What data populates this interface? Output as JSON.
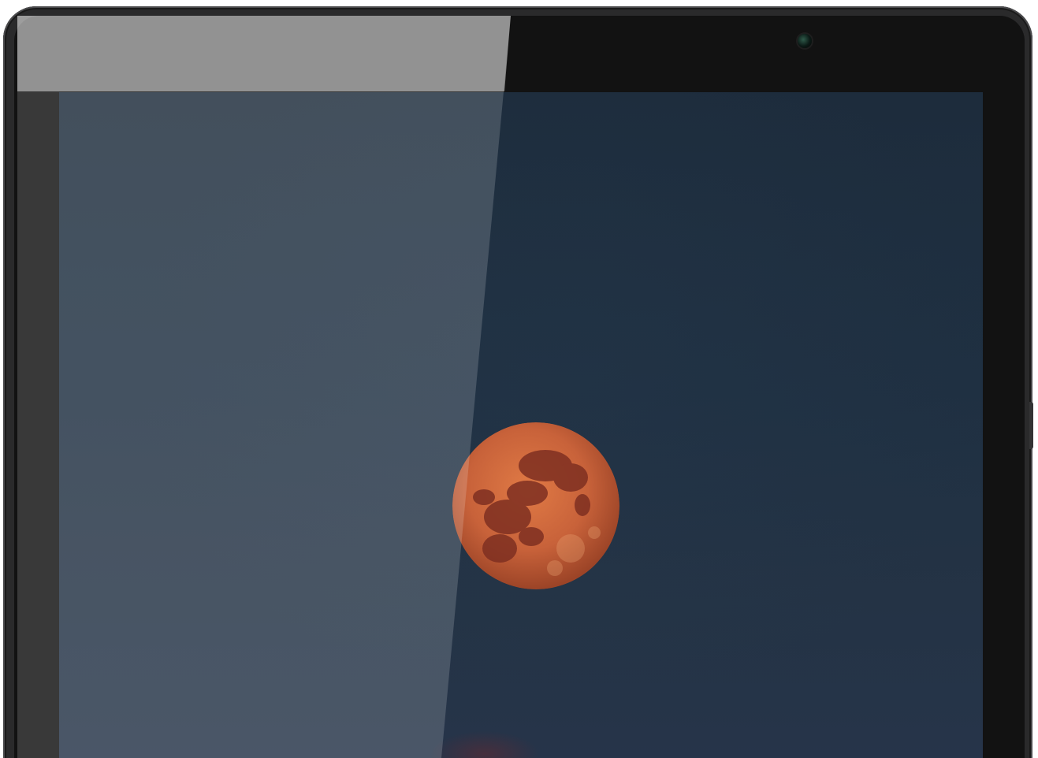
{
  "scene": {
    "subject": "tablet-front-view",
    "wallpaper": "full-moon-night-sky",
    "colors": {
      "frame": "#2a2a2b",
      "bezel": "#121212",
      "sky_top": "#1d2c3c",
      "sky_bottom": "#26344a",
      "moon": "#c8623a",
      "moon_maria": "#7e2f22"
    }
  },
  "icons": {
    "camera": "front-camera-icon"
  }
}
